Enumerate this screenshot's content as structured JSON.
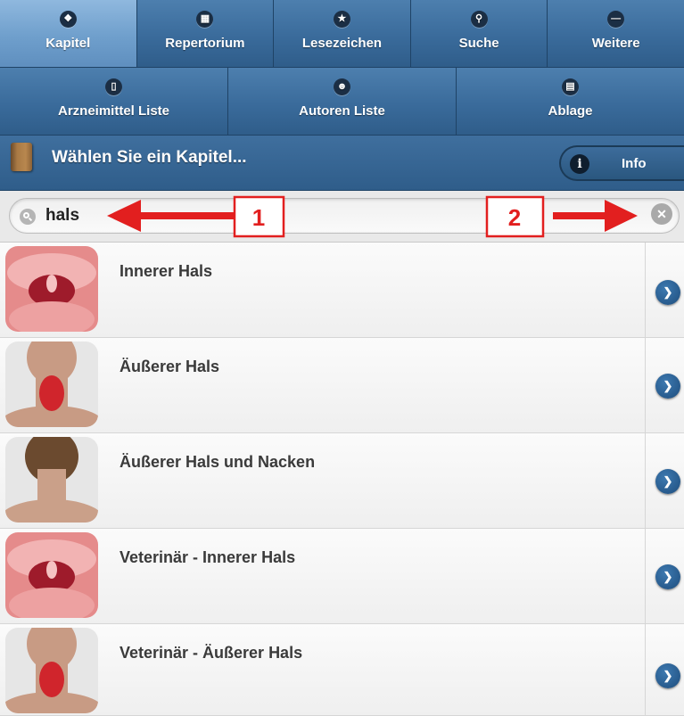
{
  "nav": {
    "row1": [
      {
        "label": "Kapitel",
        "icon": "lungs-icon",
        "active": true
      },
      {
        "label": "Repertorium",
        "icon": "grid-icon"
      },
      {
        "label": "Lesezeichen",
        "icon": "star-icon"
      },
      {
        "label": "Suche",
        "icon": "search-icon"
      },
      {
        "label": "Weitere",
        "icon": "minus-icon"
      }
    ],
    "row2": [
      {
        "label": "Arzneimittel Liste",
        "icon": "bottle-icon"
      },
      {
        "label": "Autoren Liste",
        "icon": "person-icon"
      },
      {
        "label": "Ablage",
        "icon": "document-icon"
      }
    ]
  },
  "header": {
    "title": "Wählen Sie ein Kapitel...",
    "info_label": "Info"
  },
  "search": {
    "value": "hals"
  },
  "annotations": {
    "marker1": "1",
    "marker2": "2",
    "color": "#e21f1f"
  },
  "list": [
    {
      "title": "Innerer Hals",
      "thumb": "inner-throat"
    },
    {
      "title": "Äußerer Hals",
      "thumb": "outer-neck-front"
    },
    {
      "title": "Äußerer Hals und Nacken",
      "thumb": "neck-back"
    },
    {
      "title": "Veterinär - Innerer Hals",
      "thumb": "inner-throat"
    },
    {
      "title": "Veterinär - Äußerer Hals",
      "thumb": "outer-neck-front"
    }
  ],
  "colors": {
    "nav_blue": "#3a6b9b",
    "nav_active": "#6f9fcc",
    "arrow_blue": "#1e4d7d"
  }
}
